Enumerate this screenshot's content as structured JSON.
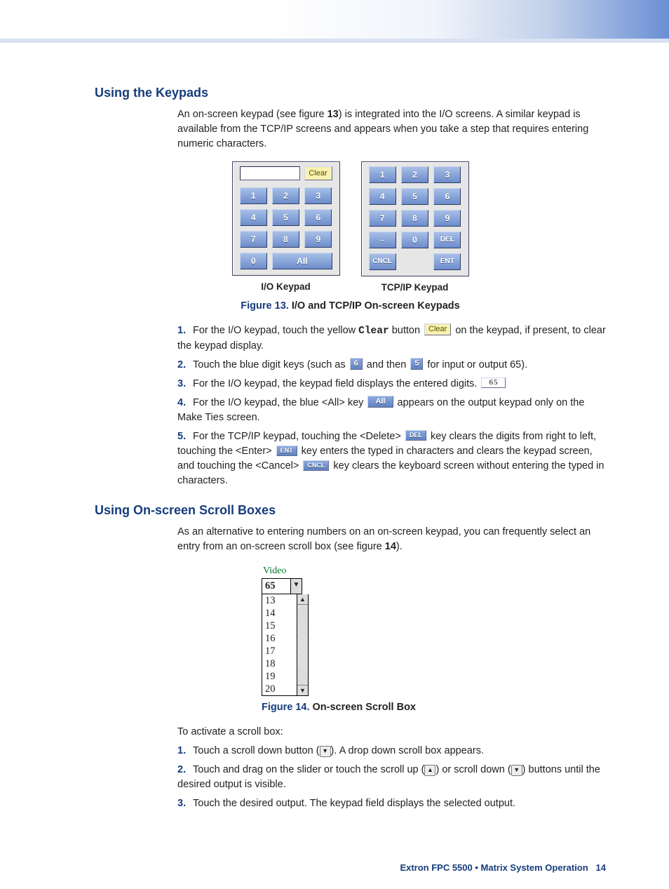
{
  "section1": {
    "heading": "Using the Keypads",
    "intro_a": "An on-screen keypad (see figure ",
    "intro_fig": "13",
    "intro_b": ") is integrated into the I/O screens. A similar keypad is available from the TCP/IP screens and appears when you take a step that requires entering numeric characters."
  },
  "keypads": {
    "clear": "Clear",
    "digits": [
      "1",
      "2",
      "3",
      "4",
      "5",
      "6",
      "7",
      "8",
      "9"
    ],
    "zero": "0",
    "all": "All",
    "dash": "-",
    "del": "DEL",
    "cncl": "CNCL",
    "ent": "ENT",
    "caption_io": "I/O Keypad",
    "caption_tcp": "TCP/IP Keypad"
  },
  "fig13": {
    "label": "Figure 13.",
    "title": "I/O and TCP/IP On-screen Keypads"
  },
  "steps1": {
    "s1n": "1.",
    "s1a": "For the I/O keypad, touch the yellow ",
    "s1_clear_word": "Clear",
    "s1b": " button ",
    "s1_btn": "Clear",
    "s1c": " on the keypad, if present, to clear the keypad display.",
    "s2n": "2.",
    "s2a": "Touch the blue digit keys (such as ",
    "s2_k1": "6",
    "s2b": " and then ",
    "s2_k2": "5",
    "s2c": " for input or output 65).",
    "s3n": "3.",
    "s3a": "For the I/O keypad, the keypad field displays the entered digits. ",
    "s3_field": "65",
    "s4n": "4.",
    "s4a": "For the I/O keypad, the blue <All> key ",
    "s4_btn": "All",
    "s4b": " appears on the output keypad only on the Make Ties screen.",
    "s5n": "5.",
    "s5a": "For the TCP/IP keypad, touching the <Delete> ",
    "s5_del": "DEL",
    "s5b": " key clears the digits from right to left, touching the <Enter> ",
    "s5_ent": "ENT",
    "s5c": " key enters the typed in characters and clears the keypad screen, and touching the <Cancel> ",
    "s5_cncl": "CNCL",
    "s5d": " key clears the keyboard screen without entering the typed in characters."
  },
  "section2": {
    "heading": "Using On-screen Scroll Boxes",
    "intro_a": "As an alternative to entering numbers on an on-screen keypad, you can frequently select an entry from an on-screen scroll box (see figure ",
    "intro_fig": "14",
    "intro_b": ").",
    "activate": "To activate a scroll box:"
  },
  "scrollbox": {
    "label": "Video",
    "selected": "65",
    "items": [
      "13",
      "14",
      "15",
      "16",
      "17",
      "18",
      "19",
      "20"
    ]
  },
  "fig14": {
    "label": "Figure 14.",
    "title": "On-screen Scroll Box"
  },
  "steps2": {
    "s1n": "1.",
    "s1a": "Touch a scroll down button (",
    "s1b": "). A drop down scroll box appears.",
    "s2n": "2.",
    "s2a": "Touch and drag on the slider or touch the scroll up (",
    "s2b": ") or scroll down (",
    "s2c": ") buttons until the desired output is visible.",
    "s3n": "3.",
    "s3": "Touch the desired output. The keypad field displays the selected output."
  },
  "footer": {
    "text": "Extron FPC 5500 • Matrix System Operation",
    "page": "14"
  }
}
